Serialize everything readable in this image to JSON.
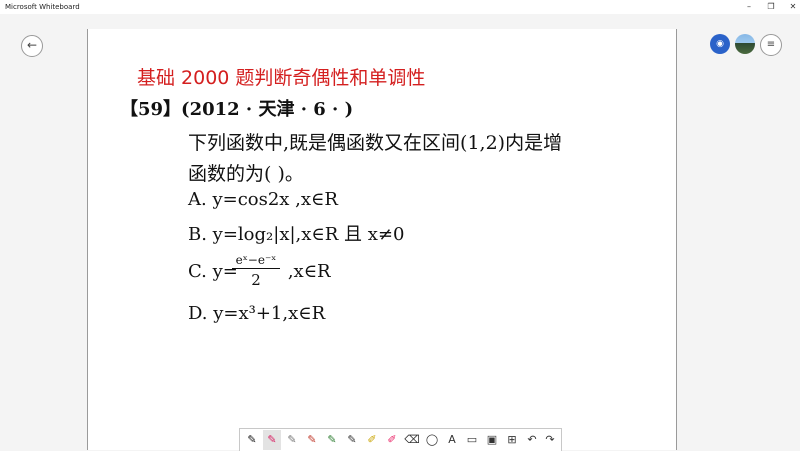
{
  "window": {
    "title": "Microsoft Whiteboard",
    "minimize": "–",
    "maximize": "❐",
    "close": "✕"
  },
  "nav": {
    "back_glyph": "←",
    "user_glyph": "ᴀ",
    "more_glyph": "≡"
  },
  "content": {
    "heading": "基础 2000 题判断奇偶性和单调性",
    "question_head": "【59】(2012 · 天津 · 6 · )",
    "line1": "下列函数中,既是偶函数又在区间(1,2)内是增",
    "line2": "函数的为(      )。",
    "optA": "A.   y=cos2x ,x∈R",
    "optB": "B.   y=log₂|x|,x∈R 且 x≠0",
    "optC_prefix": "C.   y=",
    "optC_num": "eˣ−e⁻ˣ",
    "optC_den": "2",
    "optC_suffix": ",x∈R",
    "optD": "D.   y=x³+1,x∈R"
  },
  "toolbar": [
    {
      "name": "black-pen",
      "glyph": "✎",
      "color": "#111111"
    },
    {
      "name": "pink-pen",
      "glyph": "✎",
      "color": "#d81b60"
    },
    {
      "name": "gray-pen",
      "glyph": "✎",
      "color": "#777777"
    },
    {
      "name": "red-pen",
      "glyph": "✎",
      "color": "#c0392b"
    },
    {
      "name": "green-pen",
      "glyph": "✎",
      "color": "#2e7d32"
    },
    {
      "name": "dark-pen",
      "glyph": "✎",
      "color": "#333333"
    },
    {
      "name": "yellow-highlighter",
      "glyph": "✐",
      "color": "#c9a400"
    },
    {
      "name": "pink-highlighter",
      "glyph": "✐",
      "color": "#e91e63"
    },
    {
      "name": "eraser",
      "glyph": "⌫",
      "color": "#555555"
    },
    {
      "name": "lasso",
      "glyph": "◯",
      "color": "#555555"
    },
    {
      "name": "text",
      "glyph": "A",
      "color": "#555555"
    },
    {
      "name": "note",
      "glyph": "▭",
      "color": "#555555"
    },
    {
      "name": "image",
      "glyph": "▣",
      "color": "#555555"
    },
    {
      "name": "insert",
      "glyph": "⊞",
      "color": "#555555"
    },
    {
      "name": "undo",
      "glyph": "↶",
      "color": "#555555"
    },
    {
      "name": "redo",
      "glyph": "↷",
      "color": "#555555"
    }
  ]
}
